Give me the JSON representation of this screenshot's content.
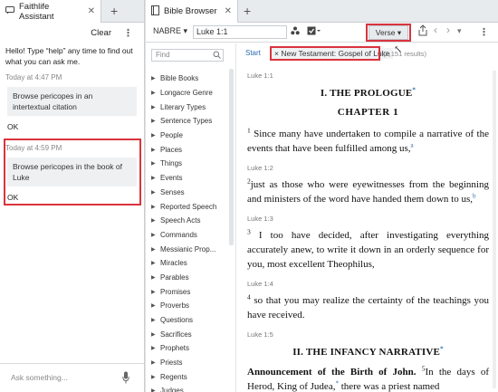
{
  "assistant": {
    "tab_title": "Faithlife Assistant",
    "clear_label": "Clear",
    "intro": "Hello! Type “help” any time to find out what you can ask me.",
    "messages": [
      {
        "time": "Today at 4:47 PM",
        "query": "Browse pericopes in an intertextual citation",
        "reply": "OK"
      },
      {
        "time": "Today at 4:59 PM",
        "query": "Browse pericopes in the book of Luke",
        "reply": "OK"
      }
    ],
    "ask_placeholder": "Ask something..."
  },
  "browser": {
    "tab_title": "Bible Browser",
    "version": "NABRE",
    "reference": "Luke 1:1",
    "verse_label": "Verse",
    "find_placeholder": "Find",
    "breadcrumb_start": "Start",
    "filter_chip": "× New Testament: Gospel of Luke",
    "results": "(1,151 results)",
    "nav_items": [
      "Bible Books",
      "Longacre Genre",
      "Literary Types",
      "Sentence Types",
      "People",
      "Places",
      "Things",
      "Events",
      "Senses",
      "Reported Speech",
      "Speech Acts",
      "Commands",
      "Messianic Prop...",
      "Miracles",
      "Parables",
      "Promises",
      "Proverbs",
      "Questions",
      "Sacrifices",
      "Prophets",
      "Priests",
      "Regents",
      "Judges"
    ]
  },
  "passage": {
    "ref_1": "Luke 1:1",
    "heading_1": "I. THE PROLOGUE",
    "fn_mark_star": "*",
    "chapter": "CHAPTER 1",
    "v1_num": "1",
    "v1_text": "Since many have undertaken to compile a narrative of the events that have been fulfilled among us,",
    "v1_fn": "a",
    "ref_2": "Luke 1:2",
    "v2_num": "2",
    "v2_text": "just as those who were eyewitnesses from the beginning and ministers of the word have handed them down to us,",
    "v2_fn": "b",
    "ref_3": "Luke 1:3",
    "v3_num": "3",
    "v3_text": "I too have decided, after investigating everything accurately anew, to write it down in an orderly sequence for you, most excellent Theophilus,",
    "ref_4": "Luke 1:4",
    "v4_num": "4",
    "v4_text": "so that you may realize the certainty of the teachings you have received.",
    "ref_5": "Luke 1:5",
    "heading_2": "II. THE INFANCY NARRATIVE",
    "subheading": "Announcement of the Birth of John.",
    "v5_num": "5",
    "v5_text_a": "In the days of Herod, King of Judea,",
    "v5_text_b": "there was a priest named"
  }
}
